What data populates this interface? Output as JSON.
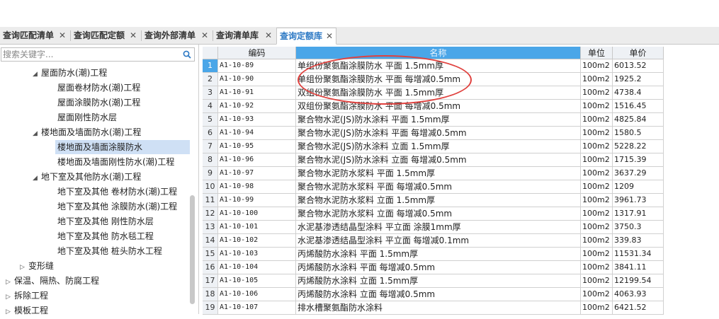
{
  "tabs": [
    {
      "label": "查询匹配清单",
      "close": "✕"
    },
    {
      "label": "查询匹配定额",
      "close": "✕"
    },
    {
      "label": "查询外部清单",
      "close": "✕"
    },
    {
      "label": "查询清单库",
      "close": "✕"
    },
    {
      "label": "查询定额库",
      "close": "✕",
      "active": true
    }
  ],
  "search": {
    "placeholder": "搜索关键字...",
    "icon": "search-icon"
  },
  "tree": [
    {
      "label": "屋面防水(潮)工程",
      "expanded": true
    },
    {
      "label": "屋面卷材防水(潮)工程"
    },
    {
      "label": "屋面涂膜防水(潮)工程"
    },
    {
      "label": "屋面刚性防水层"
    },
    {
      "label": "楼地面及墙面防水(潮)工程",
      "expanded": true
    },
    {
      "label": "楼地面及墙面涂膜防水",
      "selected": true
    },
    {
      "label": "楼地面及墙面刚性防水(潮)工程"
    },
    {
      "label": "地下室及其他防水(潮)工程",
      "expanded": true
    },
    {
      "label": "地下室及其他 卷材防水(潮)工程"
    },
    {
      "label": "地下室及其他 涂膜防水(潮)工程"
    },
    {
      "label": "地下室及其他 刚性防水层"
    },
    {
      "label": "地下室及其他 防水毯工程"
    },
    {
      "label": "地下室及其他 桩头防水工程"
    },
    {
      "label": "变形缝",
      "expanded": false
    },
    {
      "label": "保温、隔热、防腐工程",
      "expanded": false
    },
    {
      "label": "拆除工程",
      "expanded": false
    },
    {
      "label": "模板工程",
      "expanded": false
    }
  ],
  "table": {
    "columns": [
      "编码",
      "名称",
      "单位",
      "单价"
    ],
    "rows": [
      {
        "no": "1",
        "code": "A1-10-89",
        "name": "单组份聚氨酯涂膜防水 平面 1.5mm厚",
        "unit": "100m2",
        "price": "6013.52"
      },
      {
        "no": "2",
        "code": "A1-10-90",
        "name": "单组份聚氨酯涂膜防水 平面 每增减0.5mm",
        "unit": "100m2",
        "price": "1925.2"
      },
      {
        "no": "3",
        "code": "A1-10-91",
        "name": "双组份聚氨酯涂膜防水 平面 1.5mm厚",
        "unit": "100m2",
        "price": "4738.4"
      },
      {
        "no": "4",
        "code": "A1-10-92",
        "name": "双组份聚氨酯涂膜防水 平面 每增减0.5mm",
        "unit": "100m2",
        "price": "1516.45"
      },
      {
        "no": "5",
        "code": "A1-10-93",
        "name": "聚合物水泥(JS)防水涂料 平面 1.5mm厚",
        "unit": "100m2",
        "price": "4825.84"
      },
      {
        "no": "6",
        "code": "A1-10-94",
        "name": "聚合物水泥(JS)防水涂料 平面 每增减0.5mm",
        "unit": "100m2",
        "price": "1580.5"
      },
      {
        "no": "7",
        "code": "A1-10-95",
        "name": "聚合物水泥(JS)防水涂料 立面 1.5mm厚",
        "unit": "100m2",
        "price": "5228.22"
      },
      {
        "no": "8",
        "code": "A1-10-96",
        "name": "聚合物水泥(JS)防水涂料 立面 每增减0.5mm",
        "unit": "100m2",
        "price": "1715.39"
      },
      {
        "no": "9",
        "code": "A1-10-97",
        "name": "聚合物水泥防水浆料 平面 1.5mm厚",
        "unit": "100m2",
        "price": "3637.29"
      },
      {
        "no": "10",
        "code": "A1-10-98",
        "name": "聚合物水泥防水浆料 平面 每增减0.5mm",
        "unit": "100m2",
        "price": "1209"
      },
      {
        "no": "11",
        "code": "A1-10-99",
        "name": "聚合物水泥防水浆料 立面 1.5mm厚",
        "unit": "100m2",
        "price": "3961.73"
      },
      {
        "no": "12",
        "code": "A1-10-100",
        "name": "聚合物水泥防水浆料 立面 每增减0.5mm",
        "unit": "100m2",
        "price": "1317.91"
      },
      {
        "no": "13",
        "code": "A1-10-101",
        "name": "水泥基渗透结晶型涂料 平立面 涂膜1mm厚",
        "unit": "100m2",
        "price": "3750.3"
      },
      {
        "no": "14",
        "code": "A1-10-102",
        "name": "水泥基渗透结晶型涂料 平立面 每增减0.1mm",
        "unit": "100m2",
        "price": "339.83"
      },
      {
        "no": "15",
        "code": "A1-10-103",
        "name": "丙烯酸防水涂料 平面 1.5mm厚",
        "unit": "100m2",
        "price": "11531.34"
      },
      {
        "no": "16",
        "code": "A1-10-104",
        "name": "丙烯酸防水涂料 平面 每增减0.5mm",
        "unit": "100m2",
        "price": "3841.11"
      },
      {
        "no": "17",
        "code": "A1-10-105",
        "name": "丙烯酸防水涂料 立面 1.5mm厚",
        "unit": "100m2",
        "price": "12199.54"
      },
      {
        "no": "18",
        "code": "A1-10-106",
        "name": "丙烯酸防水涂料 立面 每增减0.5mm",
        "unit": "100m2",
        "price": "4063.93"
      },
      {
        "no": "19",
        "code": "A1-10-107",
        "name": "排水槽聚氨酯防水涂料",
        "unit": "100m2",
        "price": "6421.52"
      }
    ]
  },
  "colors": {
    "accent": "#2b78c4",
    "header_selected": "#4aa6e8",
    "annotation": "#e0413e"
  }
}
